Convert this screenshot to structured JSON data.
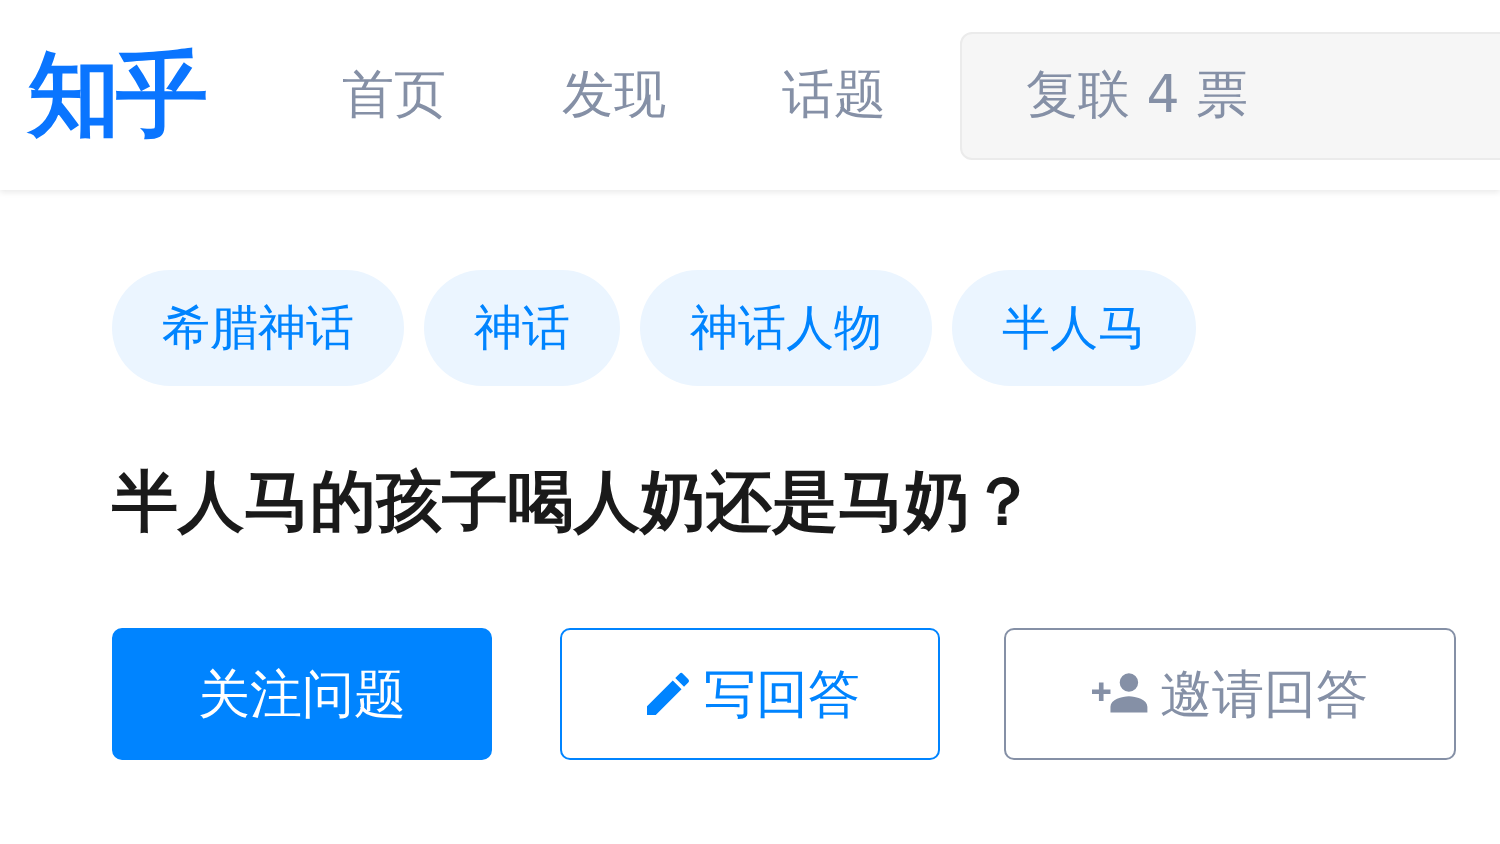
{
  "header": {
    "logo": "知乎",
    "nav": [
      {
        "label": "首页"
      },
      {
        "label": "发现"
      },
      {
        "label": "话题"
      }
    ],
    "search": {
      "placeholder": "复联 4 票"
    }
  },
  "question": {
    "topics": [
      "希腊神话",
      "神话",
      "神话人物",
      "半人马"
    ],
    "title": "半人马的孩子喝人奶还是马奶？",
    "actions": [
      {
        "kind": "follow",
        "label": "关注问题"
      },
      {
        "kind": "write",
        "label": "写回答"
      },
      {
        "kind": "invite",
        "label": "邀请回答"
      }
    ]
  }
}
